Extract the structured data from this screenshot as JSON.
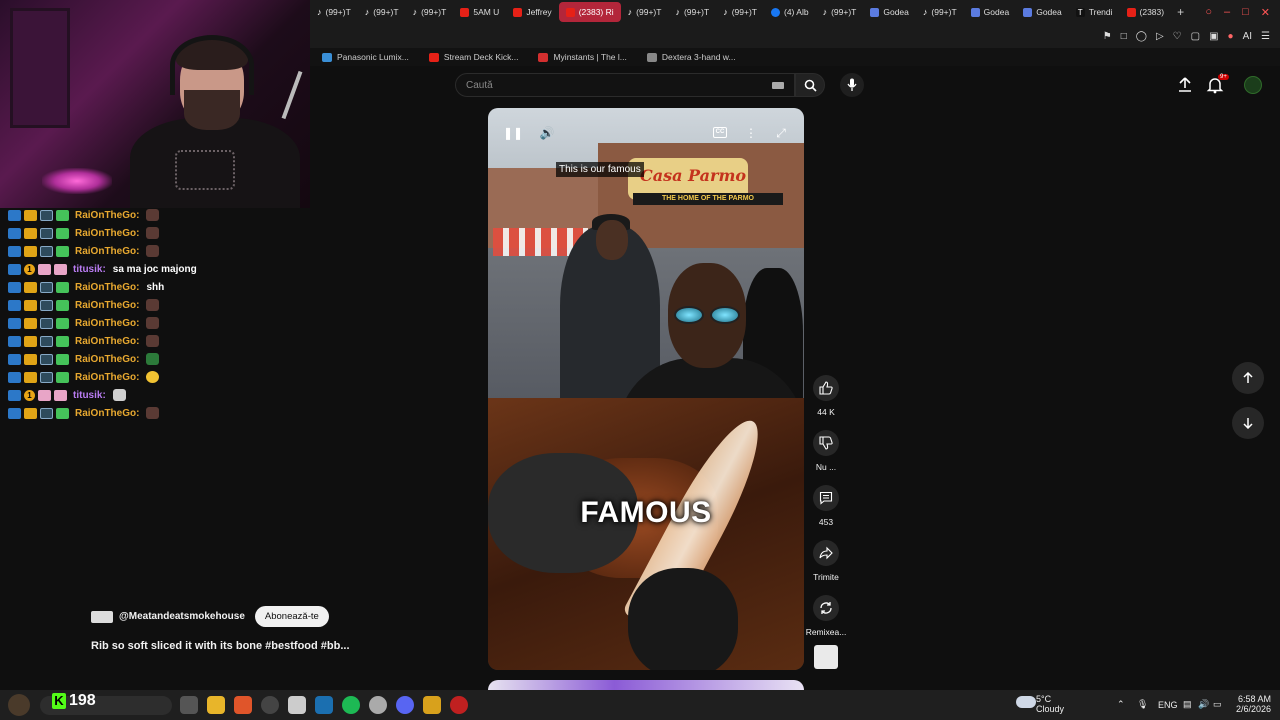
{
  "browser": {
    "tabs": [
      {
        "label": "(99+)T",
        "icon": "tiktok",
        "active": false
      },
      {
        "label": "(99+)T",
        "icon": "tiktok",
        "active": false
      },
      {
        "label": "(99+)T",
        "icon": "tiktok",
        "active": false
      },
      {
        "label": "5AM U",
        "icon": "youtube",
        "active": false
      },
      {
        "label": "Jeffrey",
        "icon": "youtube",
        "active": false
      },
      {
        "label": "(2383) Ri",
        "icon": "youtube",
        "active": true
      },
      {
        "label": "(99+)T",
        "icon": "tiktok",
        "active": false
      },
      {
        "label": "(99+)T",
        "icon": "tiktok",
        "active": false
      },
      {
        "label": "(99+)T",
        "icon": "tiktok",
        "active": false
      },
      {
        "label": "(4) Alb",
        "icon": "facebook",
        "active": false
      },
      {
        "label": "(99+)T",
        "icon": "tiktok",
        "active": false
      },
      {
        "label": "Godea",
        "icon": "docs",
        "active": false
      },
      {
        "label": "(99+)T",
        "icon": "tiktok",
        "active": false
      },
      {
        "label": "Godea",
        "icon": "docs",
        "active": false
      },
      {
        "label": "Godea",
        "icon": "docs",
        "active": false
      },
      {
        "label": "Trendi",
        "icon": "trends",
        "active": false
      },
      {
        "label": "(2383)",
        "icon": "youtube",
        "active": false
      }
    ],
    "new_tab_symbol": "+",
    "toolbar_ai_label": "AI",
    "bookmarks": [
      {
        "label": "Panasonic Lumix...",
        "color": "#3a8fd6"
      },
      {
        "label": "Stream Deck Kick...",
        "color": "#e62117"
      },
      {
        "label": "Myinstants | The l...",
        "color": "#d32f2f"
      },
      {
        "label": "Dextera 3-hand w...",
        "color": "#888888"
      }
    ]
  },
  "chat": {
    "messages": [
      {
        "user": "RaiOnTheGo:",
        "color": "yellow",
        "text": "",
        "emote": "brown"
      },
      {
        "user": "RaiOnTheGo:",
        "color": "yellow",
        "text": "",
        "emote": "brown"
      },
      {
        "user": "RaiOnTheGo:",
        "color": "yellow",
        "text": "",
        "emote": "brown"
      },
      {
        "user": "titusik:",
        "color": "purple",
        "text": "sa ma joc majong",
        "emote": ""
      },
      {
        "user": "RaiOnTheGo:",
        "color": "yellow",
        "text": "shh",
        "emote": ""
      },
      {
        "user": "RaiOnTheGo:",
        "color": "yellow",
        "text": "",
        "emote": "brown"
      },
      {
        "user": "RaiOnTheGo:",
        "color": "yellow",
        "text": "",
        "emote": "brown"
      },
      {
        "user": "RaiOnTheGo:",
        "color": "yellow",
        "text": "",
        "emote": "brown"
      },
      {
        "user": "RaiOnTheGo:",
        "color": "yellow",
        "text": "",
        "emote": "green"
      },
      {
        "user": "RaiOnTheGo:",
        "color": "yellow",
        "text": "",
        "emote": "yellow"
      },
      {
        "user": "titusik:",
        "color": "purple",
        "text": "",
        "emote": "cat"
      },
      {
        "user": "RaiOnTheGo:",
        "color": "yellow",
        "text": "",
        "emote": "brown"
      }
    ]
  },
  "youtube": {
    "search_placeholder": "Caută",
    "notification_badge": "9+",
    "video": {
      "subtitle_top": "This is our famous",
      "subtitle_big": "FAMOUS",
      "sign_text": "Casa Parmo",
      "banner_text": "THE HOME OF THE PARMO",
      "cc_label": "CC"
    },
    "actions": {
      "like_count": "44 K",
      "dislike_label": "Nu ...",
      "comment_count": "453",
      "share_label": "Trimite",
      "remix_label": "Remixea..."
    },
    "channel": {
      "handle": "@Meatandeatsmokehouse",
      "subscribe_label": "Abonează-te"
    },
    "title": "Rib so soft sliced it with its bone #bestfood  #bb..."
  },
  "taskbar": {
    "kick_viewers": "198",
    "weather_temp": "5°C",
    "weather_desc": "Cloudy",
    "language": "ENG",
    "time": "6:58 AM",
    "date": "2/6/2026"
  }
}
